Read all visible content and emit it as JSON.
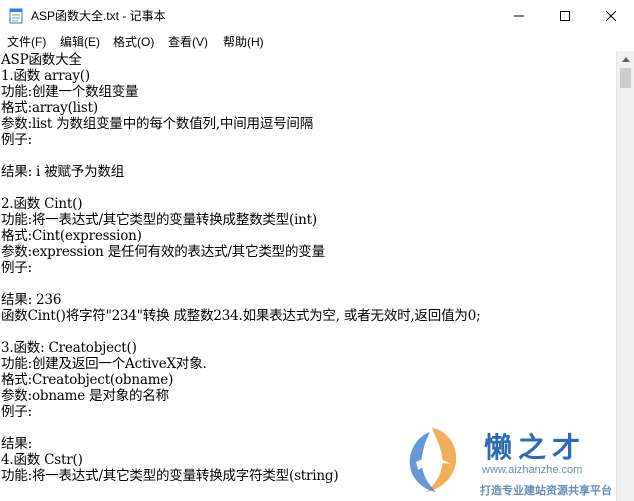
{
  "window": {
    "title": "ASP函数大全.txt - 记事本"
  },
  "menu": [
    "文件(F)",
    "编辑(E)",
    "格式(O)",
    "查看(V)",
    "帮助(H)"
  ],
  "document": {
    "lines": [
      "ASP函数大全",
      "1.函数 array()",
      "功能:创建一个数组变量",
      "格式:array(list)",
      "参数:list 为数组变量中的每个数值列,中间用逗号间隔",
      "例子:",
      "",
      "结果: i 被赋予为数组",
      "",
      "2.函数 Cint()",
      "功能:将一表达式/其它类型的变量转换成整数类型(int)",
      "格式:Cint(expression)",
      "参数:expression 是任何有效的表达式/其它类型的变量",
      "例子:",
      "",
      "结果: 236",
      "函数Cint()将字符\"234\"转换 成整数234.如果表达式为空, 或者无效时,返回值为0;",
      "",
      "3.函数: Creatobject()",
      "功能:创建及返回一个ActiveX对象.",
      "格式:Creatobject(obname)",
      "参数:obname 是对象的名称",
      "例子:",
      "",
      "结果:",
      "4.函数 Cstr()",
      "功能:将一表达式/其它类型的变量转换成字符类型(string)"
    ]
  },
  "watermark": {
    "title": "懒之才",
    "url": "www.aizhanzhe.com",
    "slogan": "打造专业建站资源共享平台"
  }
}
